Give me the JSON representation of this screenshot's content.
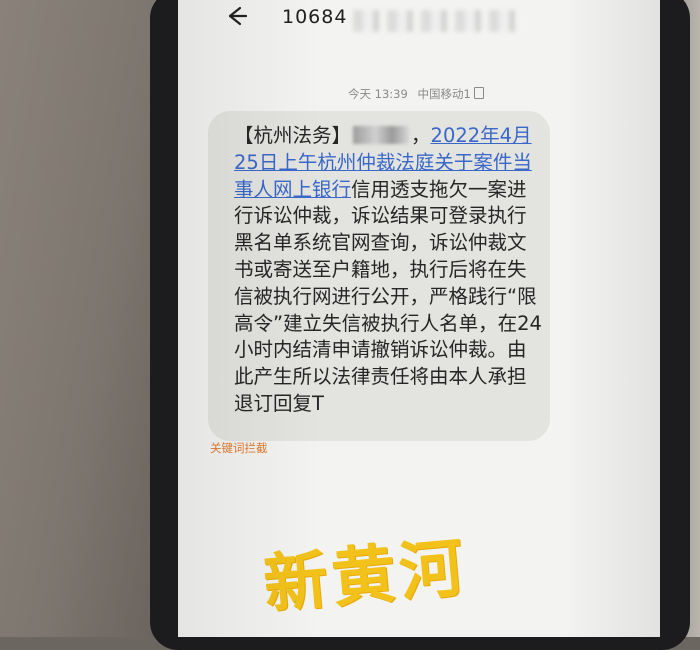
{
  "header": {
    "back_icon": "arrow-left-icon",
    "sender_number": "10684"
  },
  "message_meta": {
    "time": "今天 13:39",
    "carrier": "中国移动1",
    "sim_icon": "sim-card-icon"
  },
  "message": {
    "line1_prefix": "【杭州法务】",
    "line1_suffix": "，",
    "line1_link": "2022年4月",
    "line2_link": "25日上午杭州仲裁法庭关于案件当",
    "line3_link": "事人网上银行",
    "line3_rest": "信用透支拖欠一案进",
    "line4": "行诉讼仲裁，诉讼结果可登录执行",
    "line5": "黑名单系统官网查询，诉讼仲裁文",
    "line6": "书或寄送至户籍地，执行后将在失",
    "line7": "信被执行网进行公开，严格践行“限",
    "line8": "高令”建立失信被执行人名单，在24",
    "line9": "小时内结清申请撤销诉讼仲裁。由",
    "line10": "此产生所以法律责任将由本人承担",
    "line11": "退订回复T"
  },
  "keyword_tag": "关键词拦截",
  "watermark": "新黄河",
  "colors": {
    "link": "#3a68c9",
    "keyword": "#e07a2c",
    "watermark": "#f2c21a",
    "bubble": "#e3e3e0"
  }
}
